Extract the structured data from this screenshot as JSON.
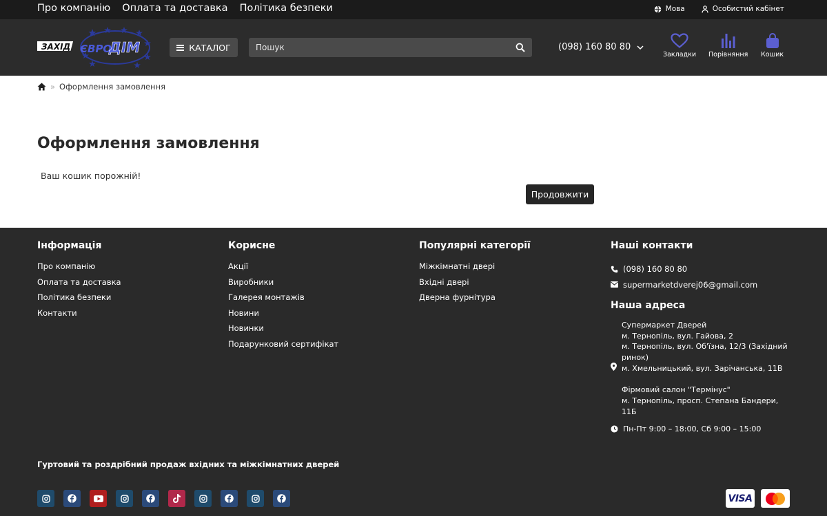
{
  "topbar": {
    "nav": [
      "Про компанію",
      "Оплата та доставка",
      "Політика безпеки"
    ],
    "language_label": "Мова",
    "account_label": "Особистий кабінет"
  },
  "header": {
    "logo_text_left": "ЗАХІД",
    "logo_text_mid": "ЄВРО",
    "logo_text_right": "ДІМ",
    "catalog_label": "КАТАЛОГ",
    "search_placeholder": "Пошук",
    "phone": "(098) 160 80 80",
    "bookmarks_label": "Закладки",
    "compare_label": "Порівняння",
    "cart_label": "Кошик",
    "accent_color": "#5b5fd1"
  },
  "breadcrumb": {
    "current": "Оформлення замовлення"
  },
  "main": {
    "title": "Оформлення замовлення",
    "empty_message": "Ваш кошик порожній!",
    "continue_label": "Продовжити"
  },
  "footer": {
    "info": {
      "title": "Інформація",
      "links": [
        "Про компанію",
        "Оплата та доставка",
        "Політика безпеки",
        "Контакти"
      ]
    },
    "useful": {
      "title": "Корисне",
      "links": [
        "Акції",
        "Виробники",
        "Галерея монтажів",
        "Новини",
        "Новинки",
        "Подарунковий сертифікат"
      ]
    },
    "popular": {
      "title": "Популярні категорії",
      "links": [
        "Міжкімнатні двері",
        "Вхідні двері",
        "Дверна фурнітура"
      ]
    },
    "contacts": {
      "title": "Наші контакти",
      "phone": "(098) 160 80 80",
      "email": "supermarketdverej06@gmail.com",
      "address_title": "Наша адреса",
      "address_lines": [
        "Супермаркет Дверей",
        "м. Тернопіль, вул. Гайова, 2",
        "м. Тернопіль, вул. Об'їзна, 12/3 (Західний ринок)",
        "м. Хмельницький, вул. Зарічанська, 11В"
      ],
      "salon_lines": [
        "Фірмовий салон \"Термінус\"",
        "м. Тернопіль, просп. Степана Бандери, 11Б"
      ],
      "hours": "Пн-Пт 9:00 – 18:00, Сб 9:00 – 15:00"
    },
    "tagline": "Гуртовий та роздрібний продаж вхідних та міжкімнатних дверей",
    "socials": [
      {
        "icon": "instagram-icon",
        "color": "#1f4b6b"
      },
      {
        "icon": "facebook-icon",
        "color": "#2b4a7a"
      },
      {
        "icon": "youtube-icon",
        "color": "#b01e1e"
      },
      {
        "icon": "instagram-icon",
        "color": "#1f4b6b"
      },
      {
        "icon": "facebook-icon",
        "color": "#2b4a7a"
      },
      {
        "icon": "tiktok-icon",
        "color": "#b0284a"
      },
      {
        "icon": "instagram-icon",
        "color": "#1f4b6b"
      },
      {
        "icon": "facebook-icon",
        "color": "#2b4a7a"
      },
      {
        "icon": "instagram-icon",
        "color": "#1f4b6b"
      },
      {
        "icon": "facebook-icon",
        "color": "#2b4a7a"
      }
    ],
    "payments": {
      "visa_label": "VISA",
      "mastercard_icon": "mastercard-icon"
    }
  }
}
